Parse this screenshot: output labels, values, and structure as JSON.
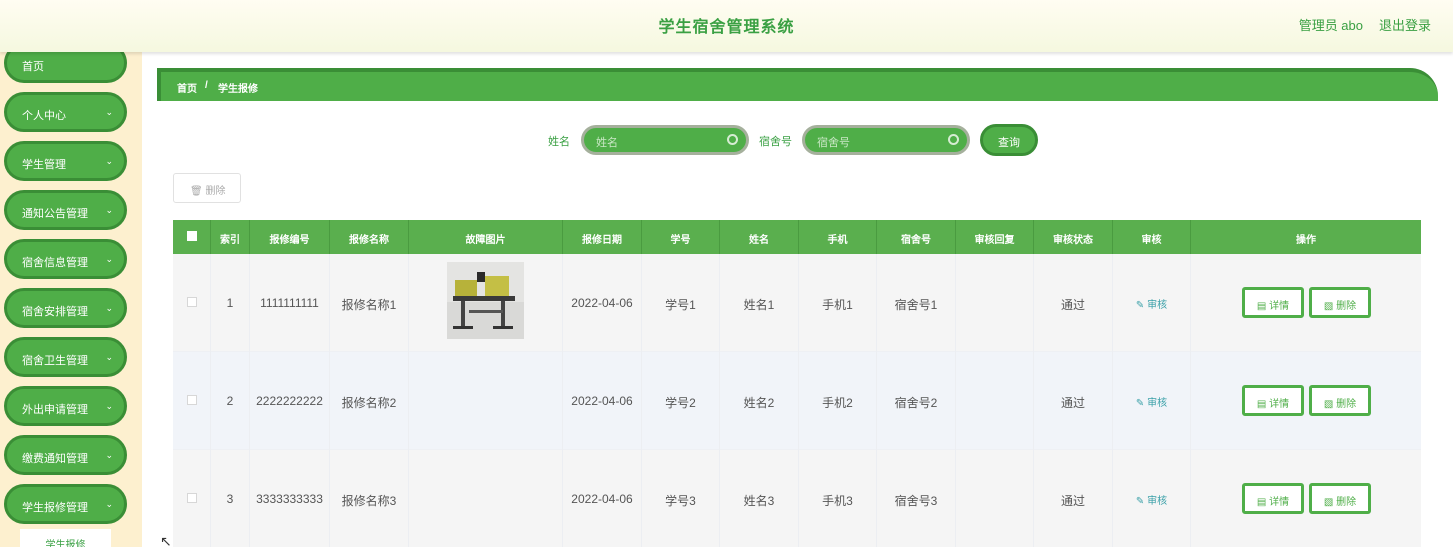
{
  "header": {
    "title": "学生宿舍管理系统",
    "user_label": "管理员 abo",
    "logout_label": "退出登录"
  },
  "sidebar": {
    "items": [
      {
        "label": "首页",
        "has_chevron": false
      },
      {
        "label": "个人中心",
        "has_chevron": true
      },
      {
        "label": "学生管理",
        "has_chevron": true
      },
      {
        "label": "通知公告管理",
        "has_chevron": true
      },
      {
        "label": "宿舍信息管理",
        "has_chevron": true
      },
      {
        "label": "宿舍安排管理",
        "has_chevron": true
      },
      {
        "label": "宿舍卫生管理",
        "has_chevron": true
      },
      {
        "label": "外出申请管理",
        "has_chevron": true
      },
      {
        "label": "缴费通知管理",
        "has_chevron": true
      },
      {
        "label": "学生报修管理",
        "has_chevron": true
      }
    ],
    "sub_item": "学生报修"
  },
  "breadcrumb": {
    "home": "首页",
    "separator": "/",
    "current": "学生报修"
  },
  "search": {
    "name_label": "姓名",
    "name_placeholder": "姓名",
    "dorm_label": "宿舍号",
    "dorm_placeholder": "宿舍号",
    "query_label": "查询"
  },
  "toolbar": {
    "delete_label": "删除"
  },
  "table": {
    "headers": [
      "索引",
      "报修编号",
      "报修名称",
      "故障图片",
      "报修日期",
      "学号",
      "姓名",
      "手机",
      "宿舍号",
      "审核回复",
      "审核状态",
      "审核",
      "操作"
    ],
    "rows": [
      {
        "index": "1",
        "code": "1111111111",
        "name": "报修名称1",
        "has_image": true,
        "date": "2022-04-06",
        "student_no": "学号1",
        "student_name": "姓名1",
        "phone": "手机1",
        "dorm": "宿舍号1",
        "reply": "",
        "status": "通过",
        "audit": "审核"
      },
      {
        "index": "2",
        "code": "2222222222",
        "name": "报修名称2",
        "has_image": false,
        "date": "2022-04-06",
        "student_no": "学号2",
        "student_name": "姓名2",
        "phone": "手机2",
        "dorm": "宿舍号2",
        "reply": "",
        "status": "通过",
        "audit": "审核"
      },
      {
        "index": "3",
        "code": "3333333333",
        "name": "报修名称3",
        "has_image": false,
        "date": "2022-04-06",
        "student_no": "学号3",
        "student_name": "姓名3",
        "phone": "手机3",
        "dorm": "宿舍号3",
        "reply": "",
        "status": "通过",
        "audit": "审核"
      }
    ],
    "detail_label": "详情",
    "delete_label": "删除"
  },
  "colors": {
    "primary": "#4fae48",
    "primary_dark": "#3a8e36",
    "text_green": "#3aa043",
    "sidebar_bg": "#fdf0cf"
  }
}
